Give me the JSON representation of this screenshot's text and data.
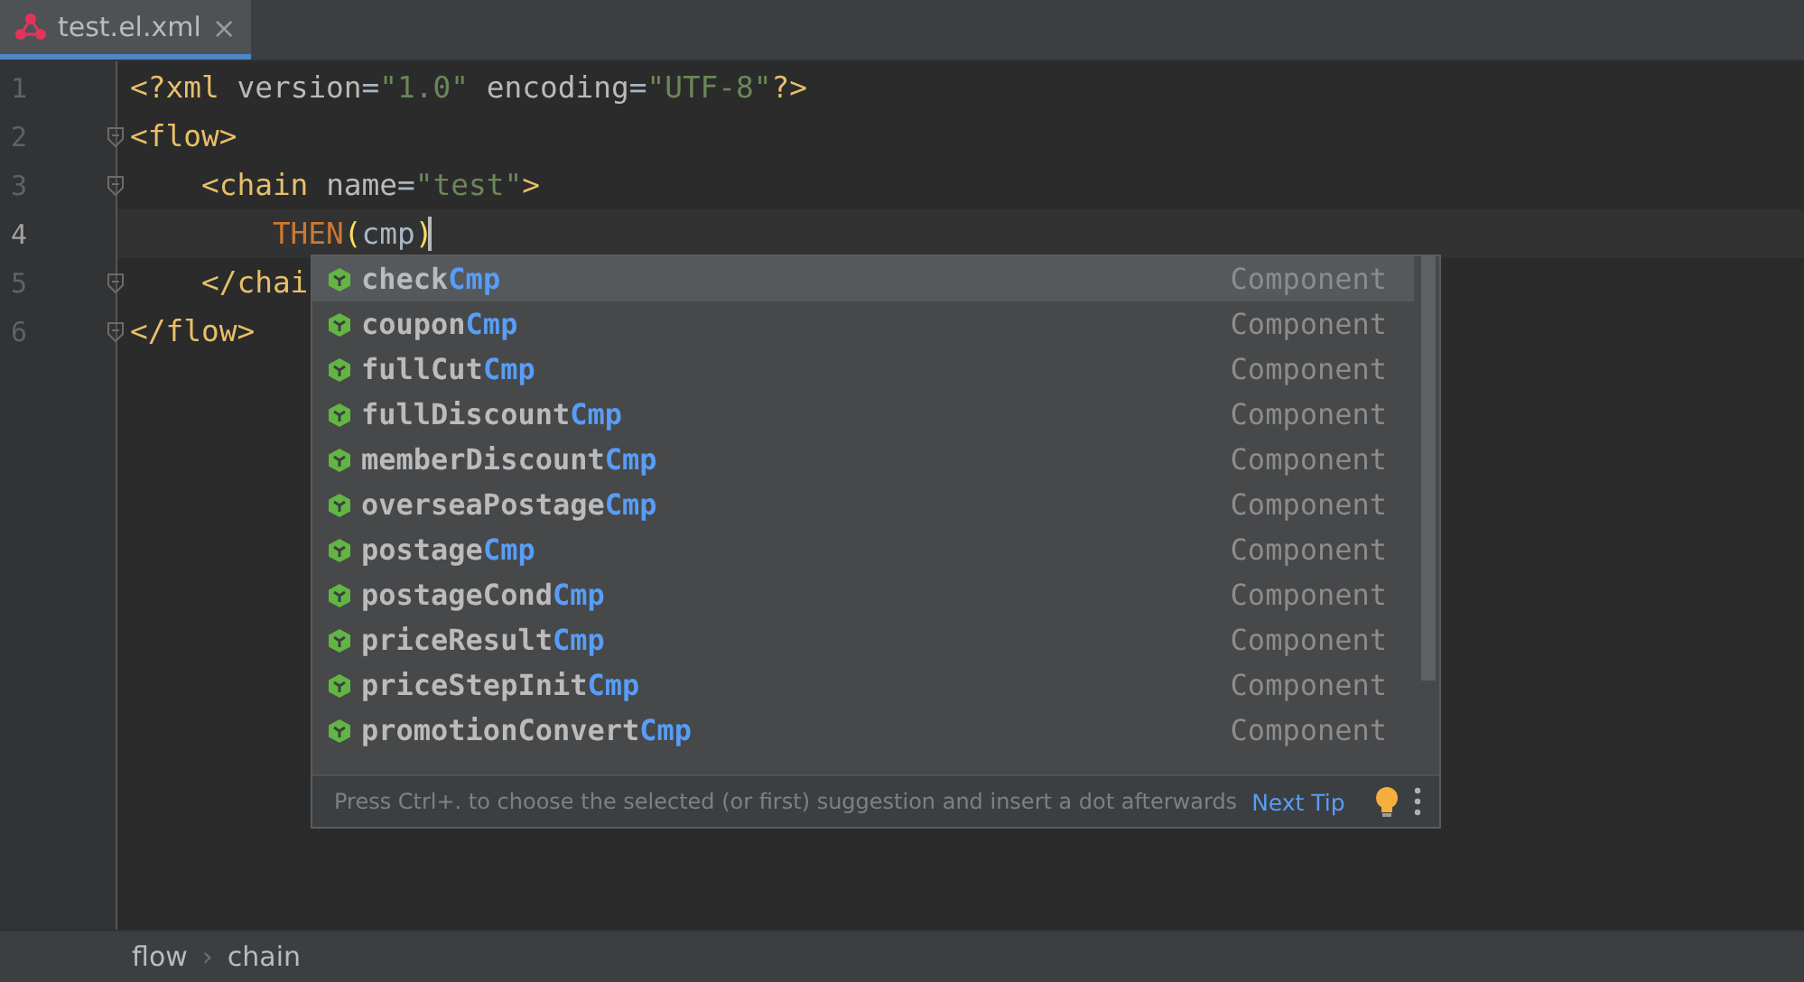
{
  "tabs": [
    {
      "label": "test.el.xml",
      "selected": true,
      "close": "×"
    }
  ],
  "editor": {
    "lines": [
      {
        "number": "1",
        "fold": false,
        "current": false,
        "tokens": [
          {
            "text": "<?xml ",
            "kind": "tag"
          },
          {
            "text": "version",
            "kind": "attr"
          },
          {
            "text": "=",
            "kind": "plain"
          },
          {
            "text": "\"1.0\"",
            "kind": "string"
          },
          {
            "text": " encoding",
            "kind": "attr"
          },
          {
            "text": "=",
            "kind": "plain"
          },
          {
            "text": "\"UTF-8\"",
            "kind": "string"
          },
          {
            "text": "?>",
            "kind": "tag"
          }
        ]
      },
      {
        "number": "2",
        "fold": true,
        "current": false,
        "tokens": [
          {
            "text": "<flow>",
            "kind": "tag"
          }
        ]
      },
      {
        "number": "3",
        "fold": true,
        "current": false,
        "tokens": [
          {
            "text": "    <chain ",
            "kind": "tag"
          },
          {
            "text": "name",
            "kind": "attr"
          },
          {
            "text": "=",
            "kind": "plain"
          },
          {
            "text": "\"test\"",
            "kind": "string"
          },
          {
            "text": ">",
            "kind": "tag"
          }
        ]
      },
      {
        "number": "4",
        "fold": false,
        "current": true,
        "tokens": [
          {
            "text": "        THEN",
            "kind": "keyword"
          },
          {
            "text": "(",
            "kind": "paren"
          },
          {
            "text": "cmp",
            "kind": "plain"
          },
          {
            "text": ")",
            "kind": "paren"
          }
        ]
      },
      {
        "number": "5",
        "fold": true,
        "current": false,
        "tokens": [
          {
            "text": "    </chai",
            "kind": "tag"
          }
        ]
      },
      {
        "number": "6",
        "fold": true,
        "current": false,
        "tokens": [
          {
            "text": "</flow>",
            "kind": "tag"
          }
        ]
      }
    ]
  },
  "completion": {
    "items": [
      {
        "prefix": "check",
        "match": "Cmp",
        "type": "Component",
        "selected": true
      },
      {
        "prefix": "coupon",
        "match": "Cmp",
        "type": "Component",
        "selected": false
      },
      {
        "prefix": "fullCut",
        "match": "Cmp",
        "type": "Component",
        "selected": false
      },
      {
        "prefix": "fullDiscount",
        "match": "Cmp",
        "type": "Component",
        "selected": false
      },
      {
        "prefix": "memberDiscount",
        "match": "Cmp",
        "type": "Component",
        "selected": false
      },
      {
        "prefix": "overseaPostage",
        "match": "Cmp",
        "type": "Component",
        "selected": false
      },
      {
        "prefix": "postage",
        "match": "Cmp",
        "type": "Component",
        "selected": false
      },
      {
        "prefix": "postageCond",
        "match": "Cmp",
        "type": "Component",
        "selected": false
      },
      {
        "prefix": "priceResult",
        "match": "Cmp",
        "type": "Component",
        "selected": false
      },
      {
        "prefix": "priceStepInit",
        "match": "Cmp",
        "type": "Component",
        "selected": false
      },
      {
        "prefix": "promotionConvert",
        "match": "Cmp",
        "type": "Component",
        "selected": false
      }
    ],
    "hint": "Press Ctrl+. to choose the selected (or first) suggestion and insert a dot afterwards",
    "next_tip": "Next Tip"
  },
  "breadcrumbs": [
    "flow",
    "chain"
  ],
  "breadcrumb_separator": "›"
}
